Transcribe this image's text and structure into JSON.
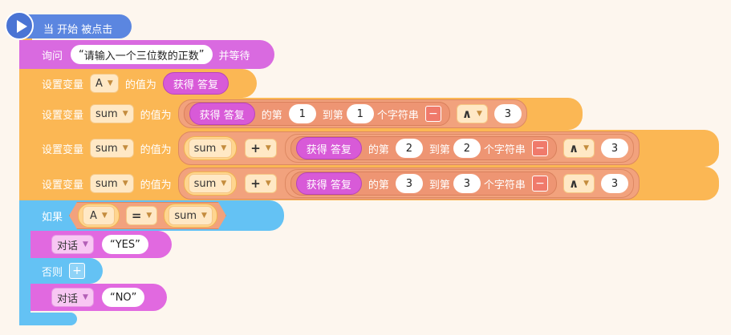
{
  "hat": {
    "label": "当 开始 被点击"
  },
  "ask": {
    "label": "询问",
    "prompt": "请输入一个三位数的正数",
    "suffix": "并等待"
  },
  "set1": {
    "label": "设置变量",
    "var": "A",
    "mid": "的值为",
    "reporter": "获得 答复"
  },
  "set2": {
    "label": "设置变量",
    "var": "sum",
    "mid": "的值为",
    "reporter": "获得 答复",
    "di": "的第",
    "from": "1",
    "dao": "到第",
    "to": "1",
    "chars": "个字符串",
    "minus": "−",
    "op": "∧",
    "num": "3"
  },
  "set3": {
    "label": "设置变量",
    "var": "sum",
    "mid": "的值为",
    "left_var": "sum",
    "plus": "+",
    "reporter": "获得 答复",
    "di": "的第",
    "from": "2",
    "dao": "到第",
    "to": "2",
    "chars": "个字符串",
    "minus": "−",
    "op": "∧",
    "num": "3"
  },
  "set4": {
    "label": "设置变量",
    "var": "sum",
    "mid": "的值为",
    "left_var": "sum",
    "plus": "+",
    "reporter": "获得 答复",
    "di": "的第",
    "from": "3",
    "dao": "到第",
    "to": "3",
    "chars": "个字符串",
    "minus": "−",
    "op": "∧",
    "num": "3"
  },
  "if": {
    "label": "如果",
    "left": "A",
    "eq": "=",
    "right": "sum",
    "else": "否则",
    "plus": "+"
  },
  "say_yes": {
    "label": "对话",
    "text": "YES"
  },
  "say_no": {
    "label": "对话",
    "text": "NO"
  },
  "colors": {
    "hat": "#5b86e0",
    "ask": "#d96ae0",
    "variable": "#fbb754",
    "control": "#64c2f4",
    "looks": "#e169e0"
  }
}
